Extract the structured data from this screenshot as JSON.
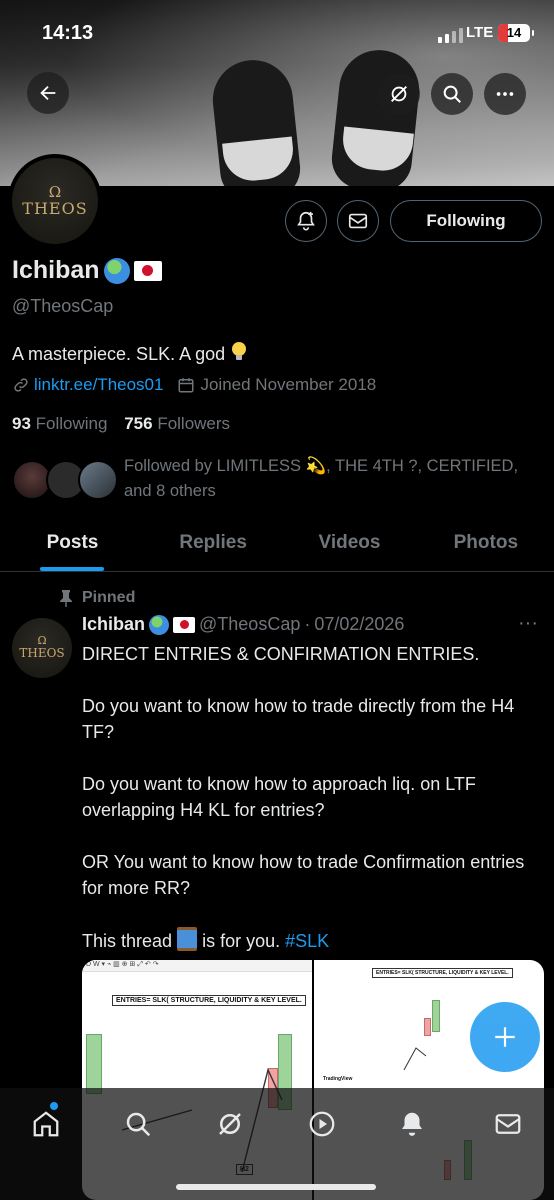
{
  "status_bar": {
    "time": "14:13",
    "network": "LTE",
    "battery": "14"
  },
  "profile": {
    "avatar_text": "THEOS",
    "avatar_symbol": "Ω",
    "name": "Ichiban",
    "handle": "@TheosCap",
    "bio": "A masterpiece. SLK. A god",
    "link": "linktr.ee/Theos01",
    "joined": "Joined November 2018",
    "following_count": "93",
    "following_label": "Following",
    "followers_count": "756",
    "followers_label": "Followers",
    "followed_by": "Followed by LIMITLESS 💫, THE 4TH ?, CERTIFIED, and 8 others",
    "follow_button": "Following"
  },
  "tabs": [
    {
      "label": "Posts",
      "active": true
    },
    {
      "label": "Replies",
      "active": false
    },
    {
      "label": "Videos",
      "active": false
    },
    {
      "label": "Photos",
      "active": false
    }
  ],
  "post": {
    "pinned_label": "Pinned",
    "author_name": "Ichiban",
    "author_handle": "@TheosCap",
    "date": "07/02/2026",
    "paragraphs": [
      "DIRECT ENTRIES & CONFIRMATION ENTRIES.",
      "Do you want to know how to trade directly from the H4 TF?",
      "Do you want to know how to approach liq. on LTF overlapping H4 KL for entries?",
      "OR You want to know how to trade Confirmation entries for more RR?"
    ],
    "last_line_start": "This thread",
    "last_line_end": "is for you.",
    "hashtag": "#SLK",
    "media_caption_1": "ENTRIES= SLK( STRUCTURE, LIQUIDITY & KEY LEVEL.",
    "media_caption_2": "ENTRIES= SLK( STRUCTURE, LIQUIDITY & KEY LEVEL.",
    "media_label_h2": "H2",
    "media_label_tv": "TradingView"
  },
  "colors": {
    "accent": "#1d9bf0",
    "text": "#e7e9ea",
    "muted": "#71767b",
    "background": "#000000"
  }
}
